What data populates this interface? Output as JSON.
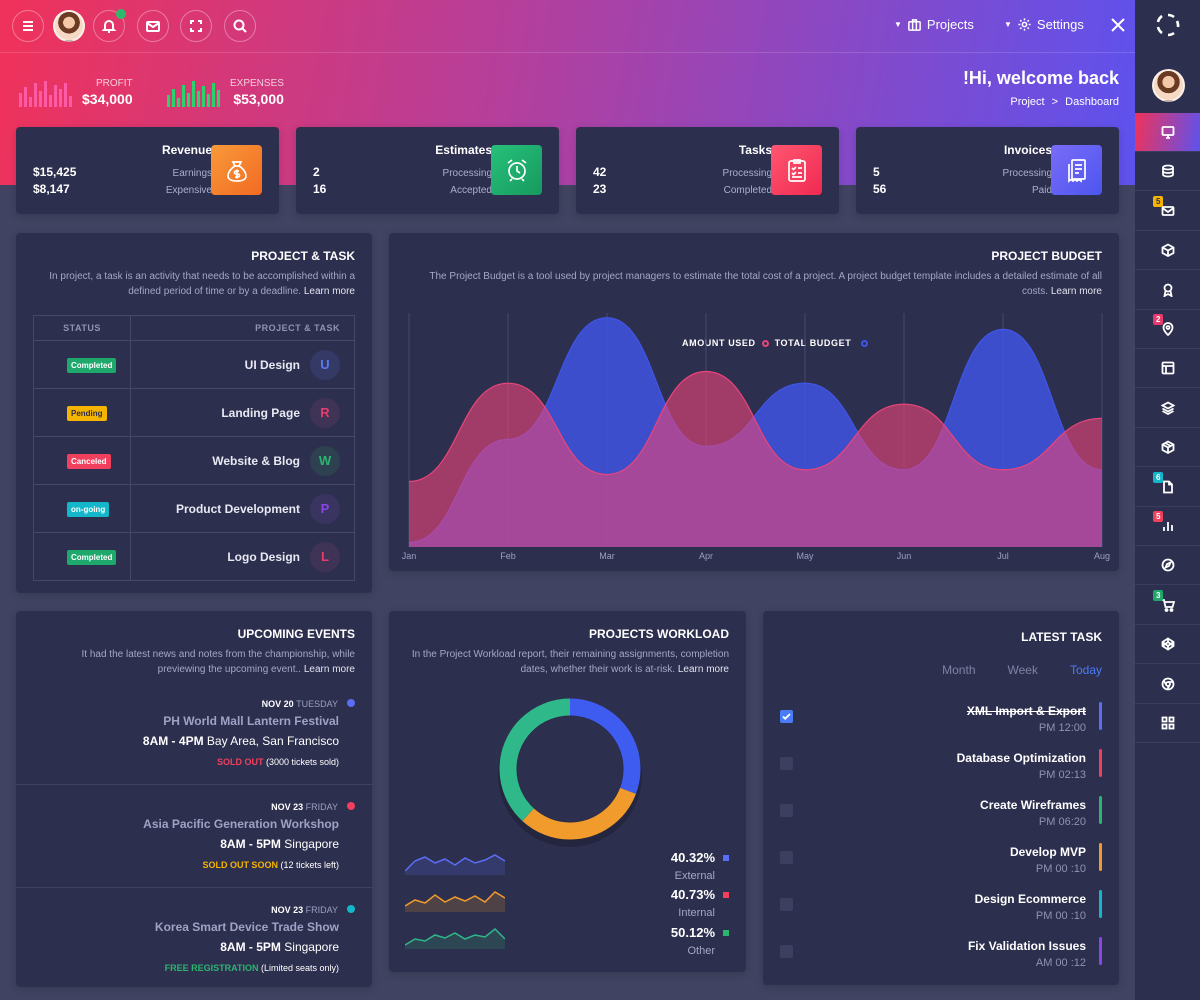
{
  "header": {
    "projects_label": "Projects",
    "settings_label": "Settings",
    "welcome": "!Hi, welcome back",
    "breadcrumb": {
      "root": "Project",
      "sep": ">",
      "current": "Dashboard"
    }
  },
  "stats": {
    "profit": {
      "label": "PROFIT",
      "value": "$34,000"
    },
    "expenses": {
      "label": "EXPENSES",
      "value": "$53,000"
    }
  },
  "mini_cards": [
    {
      "title": "Revenue",
      "n1": "$15,425",
      "n2": "$8,147",
      "s1": "Earnings",
      "s2": "Expensive",
      "icon": "money-bag-icon",
      "color": "#f07a2b"
    },
    {
      "title": "Estimates",
      "n1": "2",
      "n2": "16",
      "s1": "Processing",
      "s2": "Accepted",
      "icon": "alarm-clock-icon",
      "color": "#1ea86c"
    },
    {
      "title": "Tasks",
      "n1": "42",
      "n2": "23",
      "s1": "Processing",
      "s2": "Completed",
      "icon": "clipboard-icon",
      "color": "#f2385e"
    },
    {
      "title": "Invoices",
      "n1": "5",
      "n2": "56",
      "s1": "Processing",
      "s2": "Paid",
      "icon": "receipt-icon",
      "color": "#5a5ff0"
    }
  ],
  "project_task": {
    "title": "PROJECT & TASK",
    "desc1": "In project, a task is an activity that needs to be accomplished within a",
    "desc2": "defined period of time or by a deadline.",
    "learn_more": "Learn more",
    "col_status": "STATUS",
    "col_project": "PROJECT & TASK",
    "rows": [
      {
        "status": "Completed",
        "status_color": "#1ea86c",
        "name": "UI Design",
        "initial": "U",
        "init_color": "#5a78f0",
        "circle_bg": "#353966"
      },
      {
        "status": "Pending",
        "status_color": "#f5b400",
        "name": "Landing Page",
        "initial": "R",
        "init_color": "#e83a6d",
        "circle_bg": "#3f3456"
      },
      {
        "status": "Canceled",
        "status_color": "#f0405e",
        "name": "Website & Blog",
        "initial": "W",
        "init_color": "#2cb56f",
        "circle_bg": "#2e4150"
      },
      {
        "status": "on-going",
        "status_color": "#14b7c9",
        "name": "Product Development",
        "initial": "P",
        "init_color": "#8b45e8",
        "circle_bg": "#3a3460"
      },
      {
        "status": "Completed",
        "status_color": "#1ea86c",
        "name": "Logo Design",
        "initial": "L",
        "init_color": "#e83a6d",
        "circle_bg": "#3f3456"
      }
    ]
  },
  "budget": {
    "title": "PROJECT BUDGET",
    "desc1": "The Project Budget is a tool used by project managers to estimate the total cost of a project. A project budget template includes a detailed estimate of all",
    "desc2": "costs.",
    "learn_more": "Learn more",
    "legend_used": "AMOUNT USED",
    "legend_total": "TOTAL BUDGET"
  },
  "chart_data": {
    "type": "area",
    "categories": [
      "Jan",
      "Feb",
      "Mar",
      "Apr",
      "May",
      "Jun",
      "Jul",
      "Aug"
    ],
    "series": [
      {
        "name": "AMOUNT USED",
        "color": "#e8457a",
        "values": [
          28,
          70,
          31,
          75,
          33,
          61,
          33,
          55
        ]
      },
      {
        "name": "TOTAL BUDGET",
        "color": "#3f56e8",
        "values": [
          2,
          46,
          98,
          43,
          70,
          33,
          93,
          33
        ]
      }
    ],
    "ylim": [
      0,
      100
    ],
    "grid": true,
    "legend": "top-center"
  },
  "events": {
    "title": "UPCOMING EVENTS",
    "desc1": "It had the latest news and notes from the championship, while",
    "desc2": "previewing the upcoming event..",
    "learn_more": "Learn more",
    "items": [
      {
        "date": "NOV 20",
        "day": "TUESDAY",
        "dot": "#5b6ef5",
        "name": "PH World Mall Lantern Festival",
        "time": "8AM - 4PM",
        "place": "Bay Area, San Francisco",
        "status": "SOLD OUT",
        "status_color": "#f0405e",
        "note": "(3000 tickets sold)"
      },
      {
        "date": "NOV 23",
        "day": "FRIDAY",
        "dot": "#f0405e",
        "name": "Asia Pacific Generation Workshop",
        "time": "8AM - 5PM",
        "place": "Singapore",
        "status": "SOLD OUT SOON",
        "status_color": "#f5b400",
        "note": "(12 tickets left)"
      },
      {
        "date": "NOV 23",
        "day": "FRIDAY",
        "dot": "#14b7c9",
        "name": "Korea Smart Device Trade Show",
        "time": "8AM - 5PM",
        "place": "Singapore",
        "status": "FREE REGISTRATION",
        "status_color": "#2cb56f",
        "note": "(Limited seats only)"
      }
    ]
  },
  "workload": {
    "title": "PROJECTS WORKLOAD",
    "desc1": "In the Project Workload report, their remaining assignments, completion",
    "desc2": "dates, whether their work is at-risk.",
    "learn_more": "Learn more",
    "donut": [
      {
        "label": "External",
        "value": 40.32,
        "color": "#3f5cf0"
      },
      {
        "label": "Internal",
        "value": 40.73,
        "color": "#f19b2c"
      },
      {
        "label": "Other",
        "value": 50.12,
        "color": "#2fb88a"
      }
    ],
    "rows": [
      {
        "pct": "40.32%",
        "label": "External",
        "color": "#5b6ef5"
      },
      {
        "pct": "40.73%",
        "label": "Internal",
        "color": "#f0405e"
      },
      {
        "pct": "50.12%",
        "label": "Other",
        "color": "#2cb56f"
      }
    ]
  },
  "latest_task": {
    "title": "LATEST TASK",
    "tabs": [
      "Month",
      "Week",
      "Today"
    ],
    "active_tab": "Today",
    "items": [
      {
        "name": "XML Import & Export",
        "time": "PM 12:00",
        "done": true,
        "color": "#5b6ef5"
      },
      {
        "name": "Database Optimization",
        "time": "PM 02:13",
        "done": false,
        "color": "#f0405e"
      },
      {
        "name": "Create Wireframes",
        "time": "PM 06:20",
        "done": false,
        "color": "#2cb56f"
      },
      {
        "name": "Develop MVP",
        "time": "PM 00 :10",
        "done": false,
        "color": "#f19b2c"
      },
      {
        "name": "Design Ecommerce",
        "time": "PM 00 :10",
        "done": false,
        "color": "#14b7c9"
      },
      {
        "name": "Fix Validation Issues",
        "time": "AM 00 :12",
        "done": false,
        "color": "#8b45e8"
      }
    ]
  },
  "sidebar": {
    "items": [
      {
        "icon": "monitor-icon",
        "badge": ""
      },
      {
        "icon": "database-icon",
        "badge": ""
      },
      {
        "icon": "mail-icon",
        "badge": "5",
        "badge_color": "#f5b400"
      },
      {
        "icon": "box-icon",
        "badge": ""
      },
      {
        "icon": "award-icon",
        "badge": ""
      },
      {
        "icon": "map-pin-icon",
        "badge": "2",
        "badge_color": "#e83a6d"
      },
      {
        "icon": "layout-icon",
        "badge": ""
      },
      {
        "icon": "layers-icon",
        "badge": ""
      },
      {
        "icon": "package-icon",
        "badge": ""
      },
      {
        "icon": "file-icon",
        "badge": "6",
        "badge_color": "#14b7c9"
      },
      {
        "icon": "bar-chart-icon",
        "badge": "5",
        "badge_color": "#f0405e"
      },
      {
        "icon": "compass-icon",
        "badge": ""
      },
      {
        "icon": "cart-icon",
        "badge": "3",
        "badge_color": "#1ea86c"
      },
      {
        "icon": "codepen-icon",
        "badge": ""
      },
      {
        "icon": "chrome-icon",
        "badge": ""
      },
      {
        "icon": "grid-icon",
        "badge": ""
      }
    ]
  }
}
